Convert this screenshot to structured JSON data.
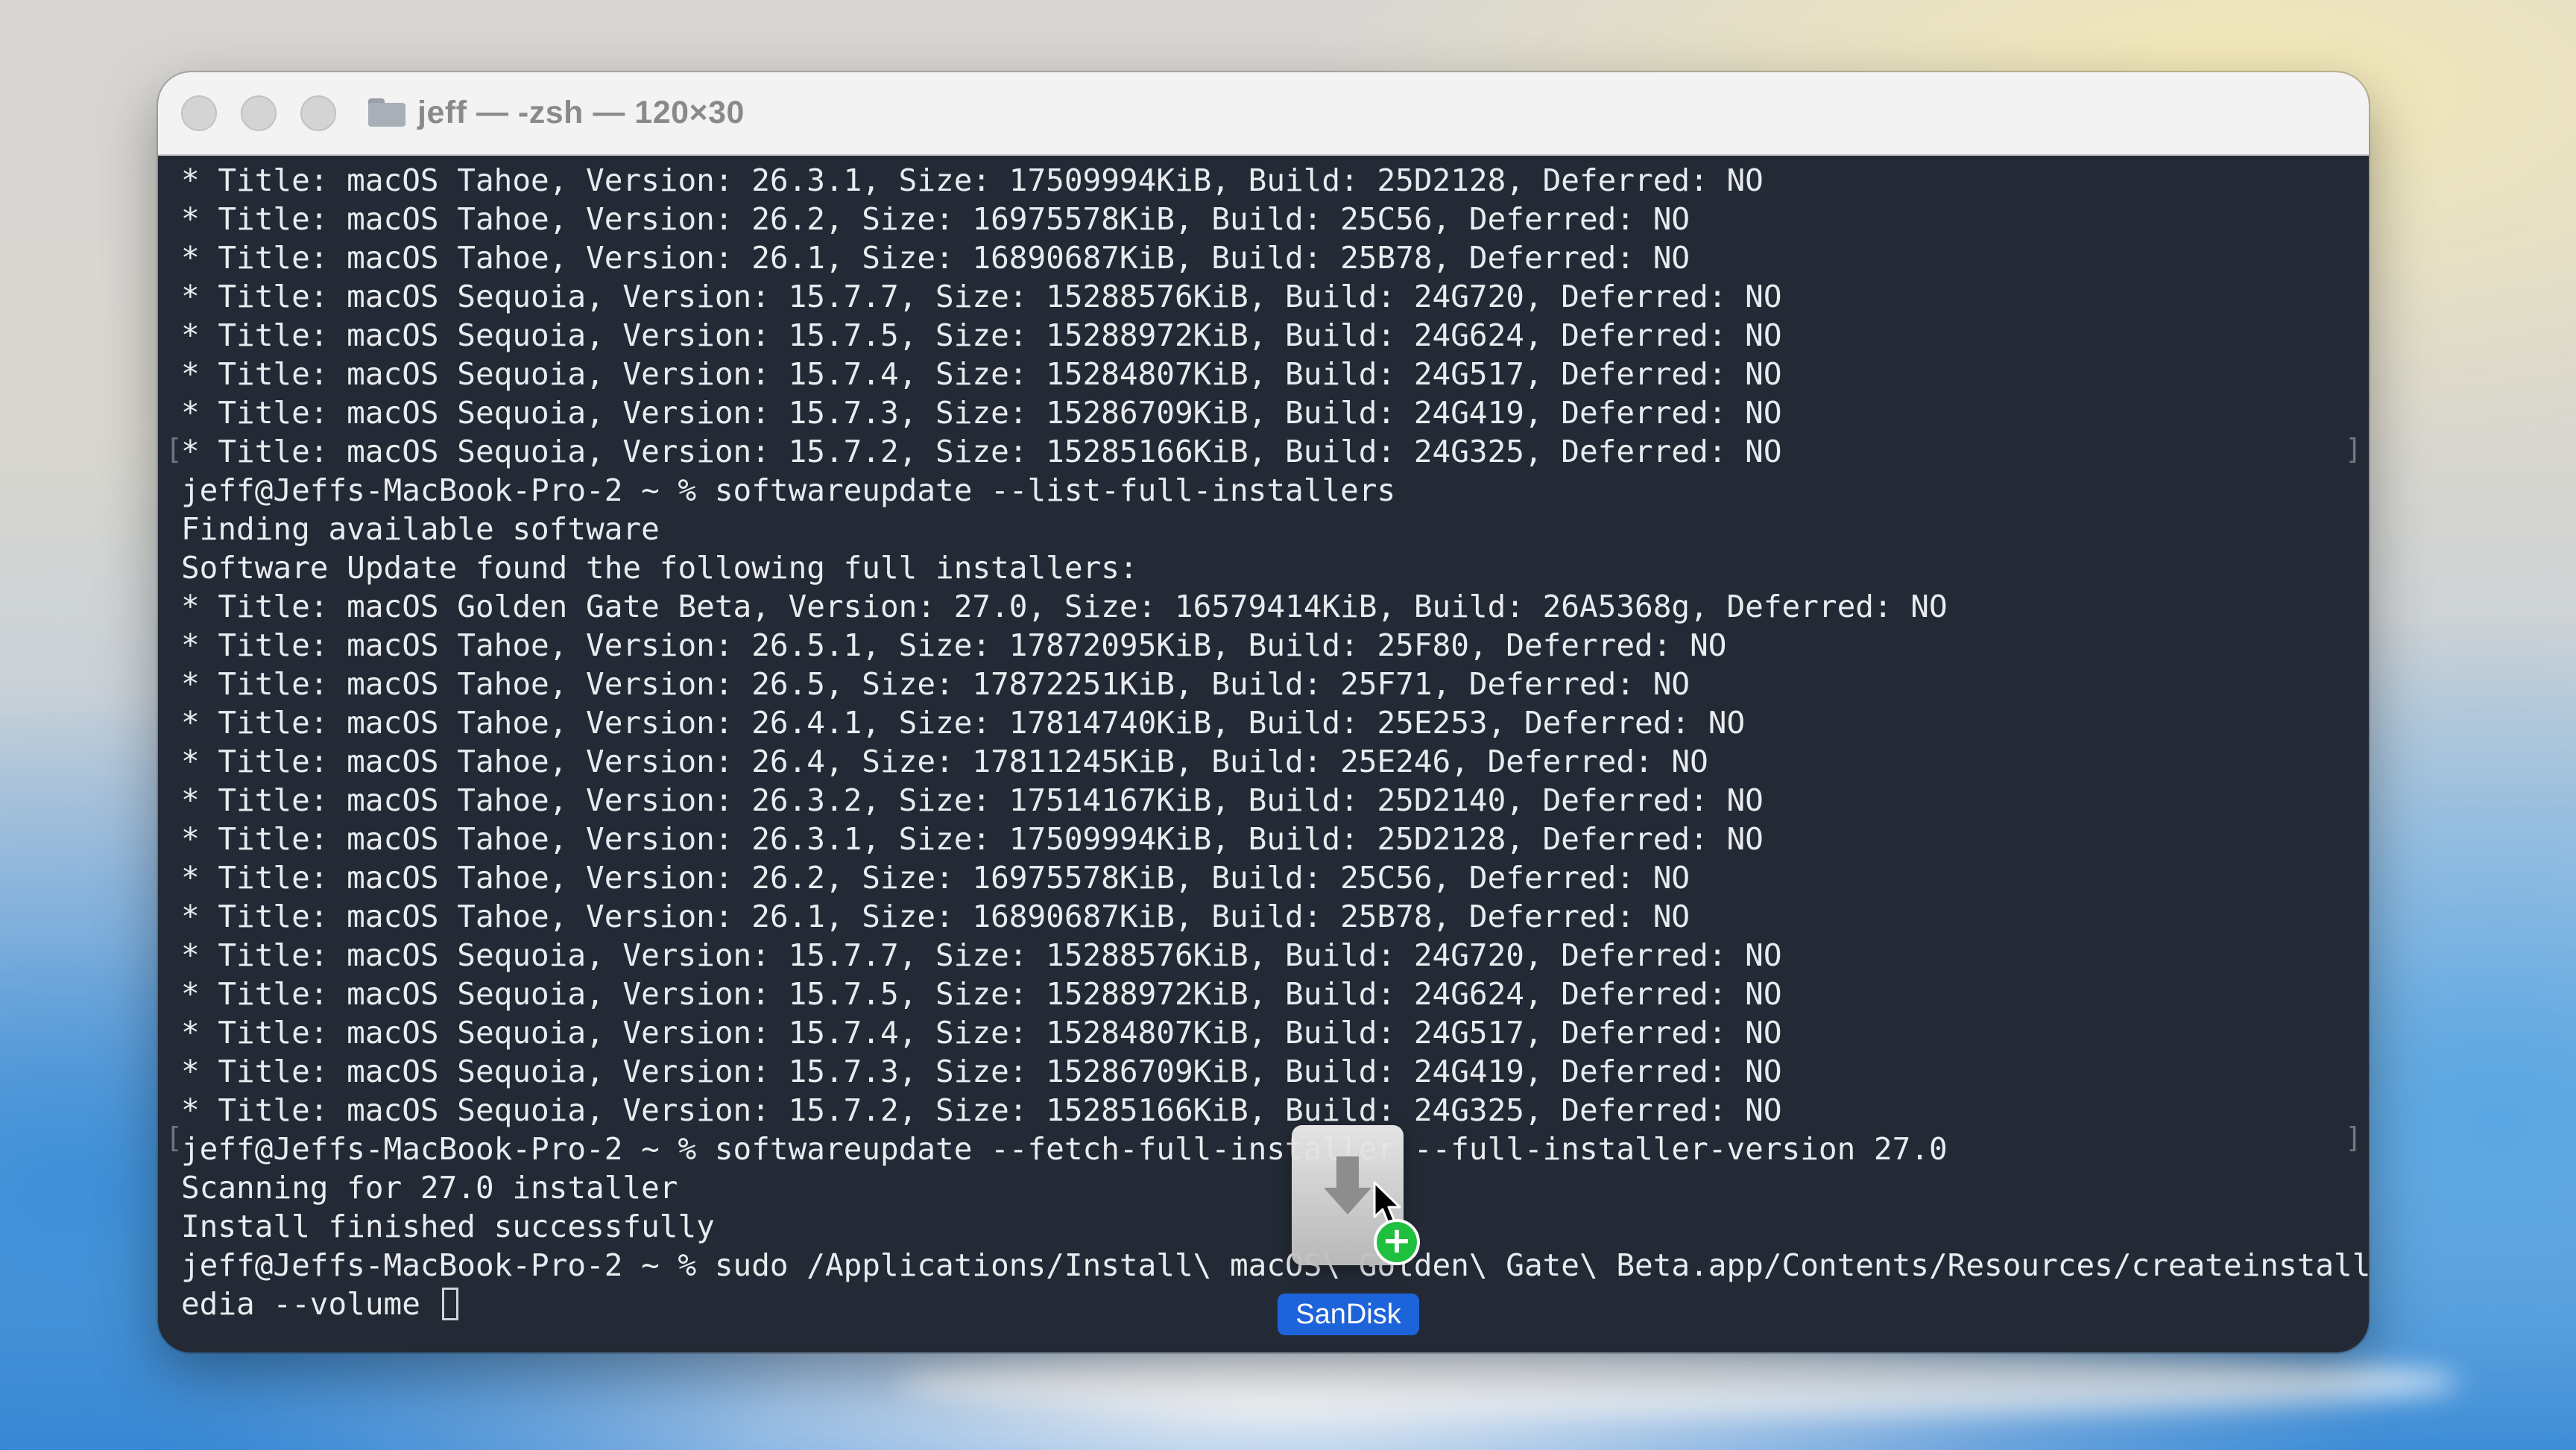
{
  "window": {
    "title": "jeff — -zsh — 120×30"
  },
  "terminal": {
    "lines": [
      "* Title: macOS Tahoe, Version: 26.3.1, Size: 17509994KiB, Build: 25D2128, Deferred: NO",
      "* Title: macOS Tahoe, Version: 26.2, Size: 16975578KiB, Build: 25C56, Deferred: NO",
      "* Title: macOS Tahoe, Version: 26.1, Size: 16890687KiB, Build: 25B78, Deferred: NO",
      "* Title: macOS Sequoia, Version: 15.7.7, Size: 15288576KiB, Build: 24G720, Deferred: NO",
      "* Title: macOS Sequoia, Version: 15.7.5, Size: 15288972KiB, Build: 24G624, Deferred: NO",
      "* Title: macOS Sequoia, Version: 15.7.4, Size: 15284807KiB, Build: 24G517, Deferred: NO",
      "* Title: macOS Sequoia, Version: 15.7.3, Size: 15286709KiB, Build: 24G419, Deferred: NO",
      "* Title: macOS Sequoia, Version: 15.7.2, Size: 15285166KiB, Build: 24G325, Deferred: NO",
      "jeff@Jeffs-MacBook-Pro-2 ~ % softwareupdate --list-full-installers",
      "Finding available software",
      "Software Update found the following full installers:",
      "* Title: macOS Golden Gate Beta, Version: 27.0, Size: 16579414KiB, Build: 26A5368g, Deferred: NO",
      "* Title: macOS Tahoe, Version: 26.5.1, Size: 17872095KiB, Build: 25F80, Deferred: NO",
      "* Title: macOS Tahoe, Version: 26.5, Size: 17872251KiB, Build: 25F71, Deferred: NO",
      "* Title: macOS Tahoe, Version: 26.4.1, Size: 17814740KiB, Build: 25E253, Deferred: NO",
      "* Title: macOS Tahoe, Version: 26.4, Size: 17811245KiB, Build: 25E246, Deferred: NO",
      "* Title: macOS Tahoe, Version: 26.3.2, Size: 17514167KiB, Build: 25D2140, Deferred: NO",
      "* Title: macOS Tahoe, Version: 26.3.1, Size: 17509994KiB, Build: 25D2128, Deferred: NO",
      "* Title: macOS Tahoe, Version: 26.2, Size: 16975578KiB, Build: 25C56, Deferred: NO",
      "* Title: macOS Tahoe, Version: 26.1, Size: 16890687KiB, Build: 25B78, Deferred: NO",
      "* Title: macOS Sequoia, Version: 15.7.7, Size: 15288576KiB, Build: 24G720, Deferred: NO",
      "* Title: macOS Sequoia, Version: 15.7.5, Size: 15288972KiB, Build: 24G624, Deferred: NO",
      "* Title: macOS Sequoia, Version: 15.7.4, Size: 15284807KiB, Build: 24G517, Deferred: NO",
      "* Title: macOS Sequoia, Version: 15.7.3, Size: 15286709KiB, Build: 24G419, Deferred: NO",
      "* Title: macOS Sequoia, Version: 15.7.2, Size: 15285166KiB, Build: 24G325, Deferred: NO",
      "jeff@Jeffs-MacBook-Pro-2 ~ % softwareupdate --fetch-full-installer --full-installer-version 27.0",
      "Scanning for 27.0 installer",
      "Install finished successfully",
      "jeff@Jeffs-MacBook-Pro-2 ~ % sudo /Applications/Install\\ macOS\\ Golden\\ Gate\\ Beta.app/Contents/Resources/createinstallm",
      "edia --volume "
    ]
  },
  "drag_item": {
    "label": "SanDisk",
    "icon": "disk-install-icon",
    "badge_icon": "plus-icon",
    "badge_glyph": "+",
    "badge_color": "#1fbf3f",
    "label_color": "#1d63d9"
  },
  "colors": {
    "terminal_background": "#232a35",
    "terminal_text": "#e9ecef"
  }
}
